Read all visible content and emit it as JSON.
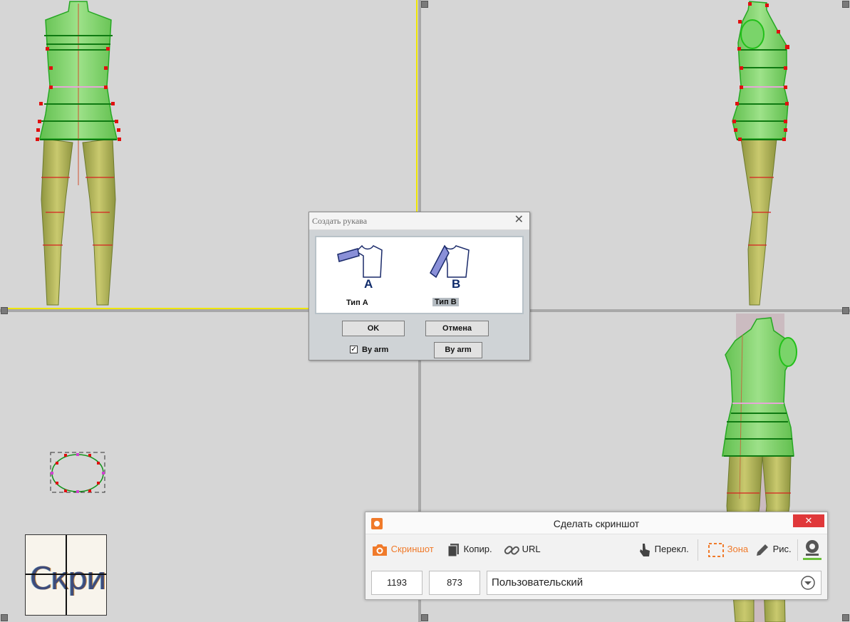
{
  "dialog": {
    "title": "Создать рукава",
    "close_symbol": "✕",
    "letter_a": "A",
    "letter_b": "B",
    "type_a_label": "Тип A",
    "type_b_label": "Тип B",
    "ok_label": "OK",
    "cancel_label": "Отмена",
    "by_arm_checkbox_label": "By arm",
    "by_arm_checked": true,
    "by_arm_button_label": "By arm"
  },
  "screenshot_tool": {
    "title": "Сделать скриншот",
    "close_symbol": "✕",
    "actions": {
      "screenshot": "Скриншот",
      "copy": "Копир.",
      "url": "URL",
      "switch": "Перекл.",
      "zone": "Зона",
      "draw": "Рис."
    },
    "width_value": "1193",
    "height_value": "873",
    "preset": "Пользовательский",
    "accent_color": "#f07a2a"
  },
  "magnifier": {
    "text": "Скри"
  },
  "colors": {
    "viewport_bg": "#d6d6d6",
    "body_green": "#7fd36a",
    "body_olive": "#b7b862",
    "marker_red": "#e01010",
    "guide_yellow": "#f0e800"
  }
}
